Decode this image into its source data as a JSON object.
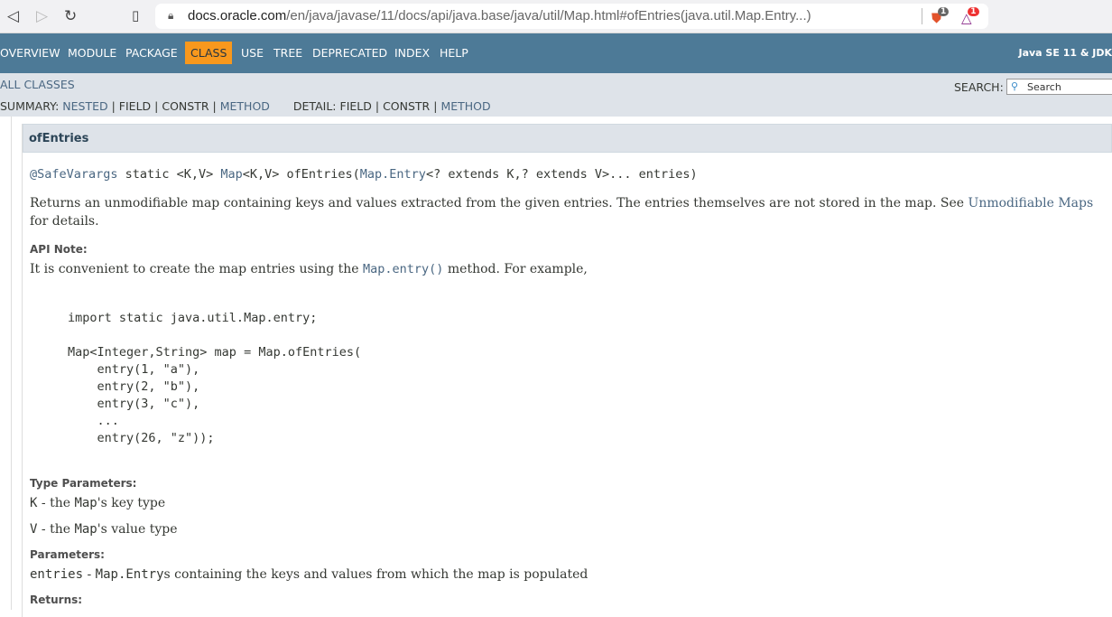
{
  "browser": {
    "url_host": "docs.oracle.com",
    "url_path": "/en/java/javase/11/docs/api/java.base/java/util/Map.html#ofEntries(java.util.Map.Entry...)",
    "brave_badge": "1",
    "rewards_badge": "1"
  },
  "nav": {
    "items": [
      "OVERVIEW",
      "MODULE",
      "PACKAGE",
      "CLASS",
      "USE",
      "TREE",
      "DEPRECATED",
      "INDEX",
      "HELP"
    ],
    "brand": "Java SE 11 & JDK"
  },
  "subnav": {
    "all_classes": "ALL CLASSES",
    "summary_label": "SUMMARY:",
    "nested": "NESTED",
    "field": "FIELD",
    "constr": "CONSTR",
    "method": "METHOD",
    "detail_label": "DETAIL:",
    "detail_field": "FIELD",
    "detail_constr": "CONSTR",
    "detail_method": "METHOD",
    "sep": "|",
    "search_label": "SEARCH:",
    "search_placeholder": "Search"
  },
  "method": {
    "name": "ofEntries",
    "sig_annotation": "@SafeVarargs",
    "sig_mid1": " static <K,V> ",
    "sig_map": "Map",
    "sig_mid2": "<K,V> ofEntries(",
    "sig_entry": "Map.Entry",
    "sig_end": "<? extends K,? extends V>... entries)",
    "desc1": "Returns an unmodifiable map containing keys and values extracted from the given entries. The entries themselves are not stored in the map. See ",
    "desc_link": "Unmodifiable Maps",
    "desc2": "for details.",
    "api_note_label": "API Note:",
    "api_note_1": "It is convenient to create the map entries using the ",
    "api_note_link": "Map.entry()",
    "api_note_2": " method. For example,",
    "code": "import static java.util.Map.entry;\n\nMap<Integer,String> map = Map.ofEntries(\n    entry(1, \"a\"),\n    entry(2, \"b\"),\n    entry(3, \"c\"),\n    ...\n    entry(26, \"z\"));",
    "type_params_label": "Type Parameters:",
    "tp_k_code": "K",
    "tp_k_1": " - the ",
    "tp_k_map": "Map",
    "tp_k_2": "'s key type",
    "tp_v_code": "V",
    "tp_v_1": " - the ",
    "tp_v_map": "Map",
    "tp_v_2": "'s value type",
    "params_label": "Parameters:",
    "param_code": "entries",
    "param_1": " - ",
    "param_map": "Map.Entry",
    "param_2": "s containing the keys and values from which the map is populated",
    "returns_label": "Returns:"
  }
}
